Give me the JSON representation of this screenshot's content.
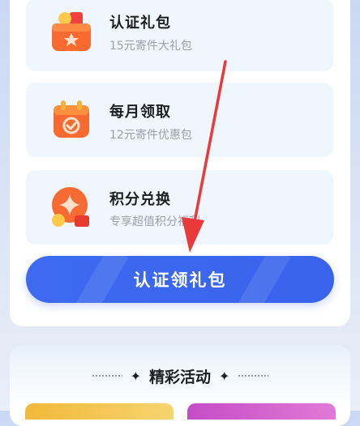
{
  "benefits": [
    {
      "title": "认证礼包",
      "desc": "15元寄件大礼包",
      "icon": "gift-box-icon"
    },
    {
      "title": "每月领取",
      "desc": "12元寄件优惠包",
      "icon": "calendar-check-icon"
    },
    {
      "title": "积分兑换",
      "desc": "专享超值积分福利",
      "icon": "points-coin-icon"
    }
  ],
  "cta": {
    "label": "认证领礼包"
  },
  "activities": {
    "title": "精彩活动"
  },
  "colors": {
    "primary": "#3b66ee",
    "card_bg": "#f0f6fd",
    "icon_orange": "#f76b33"
  }
}
